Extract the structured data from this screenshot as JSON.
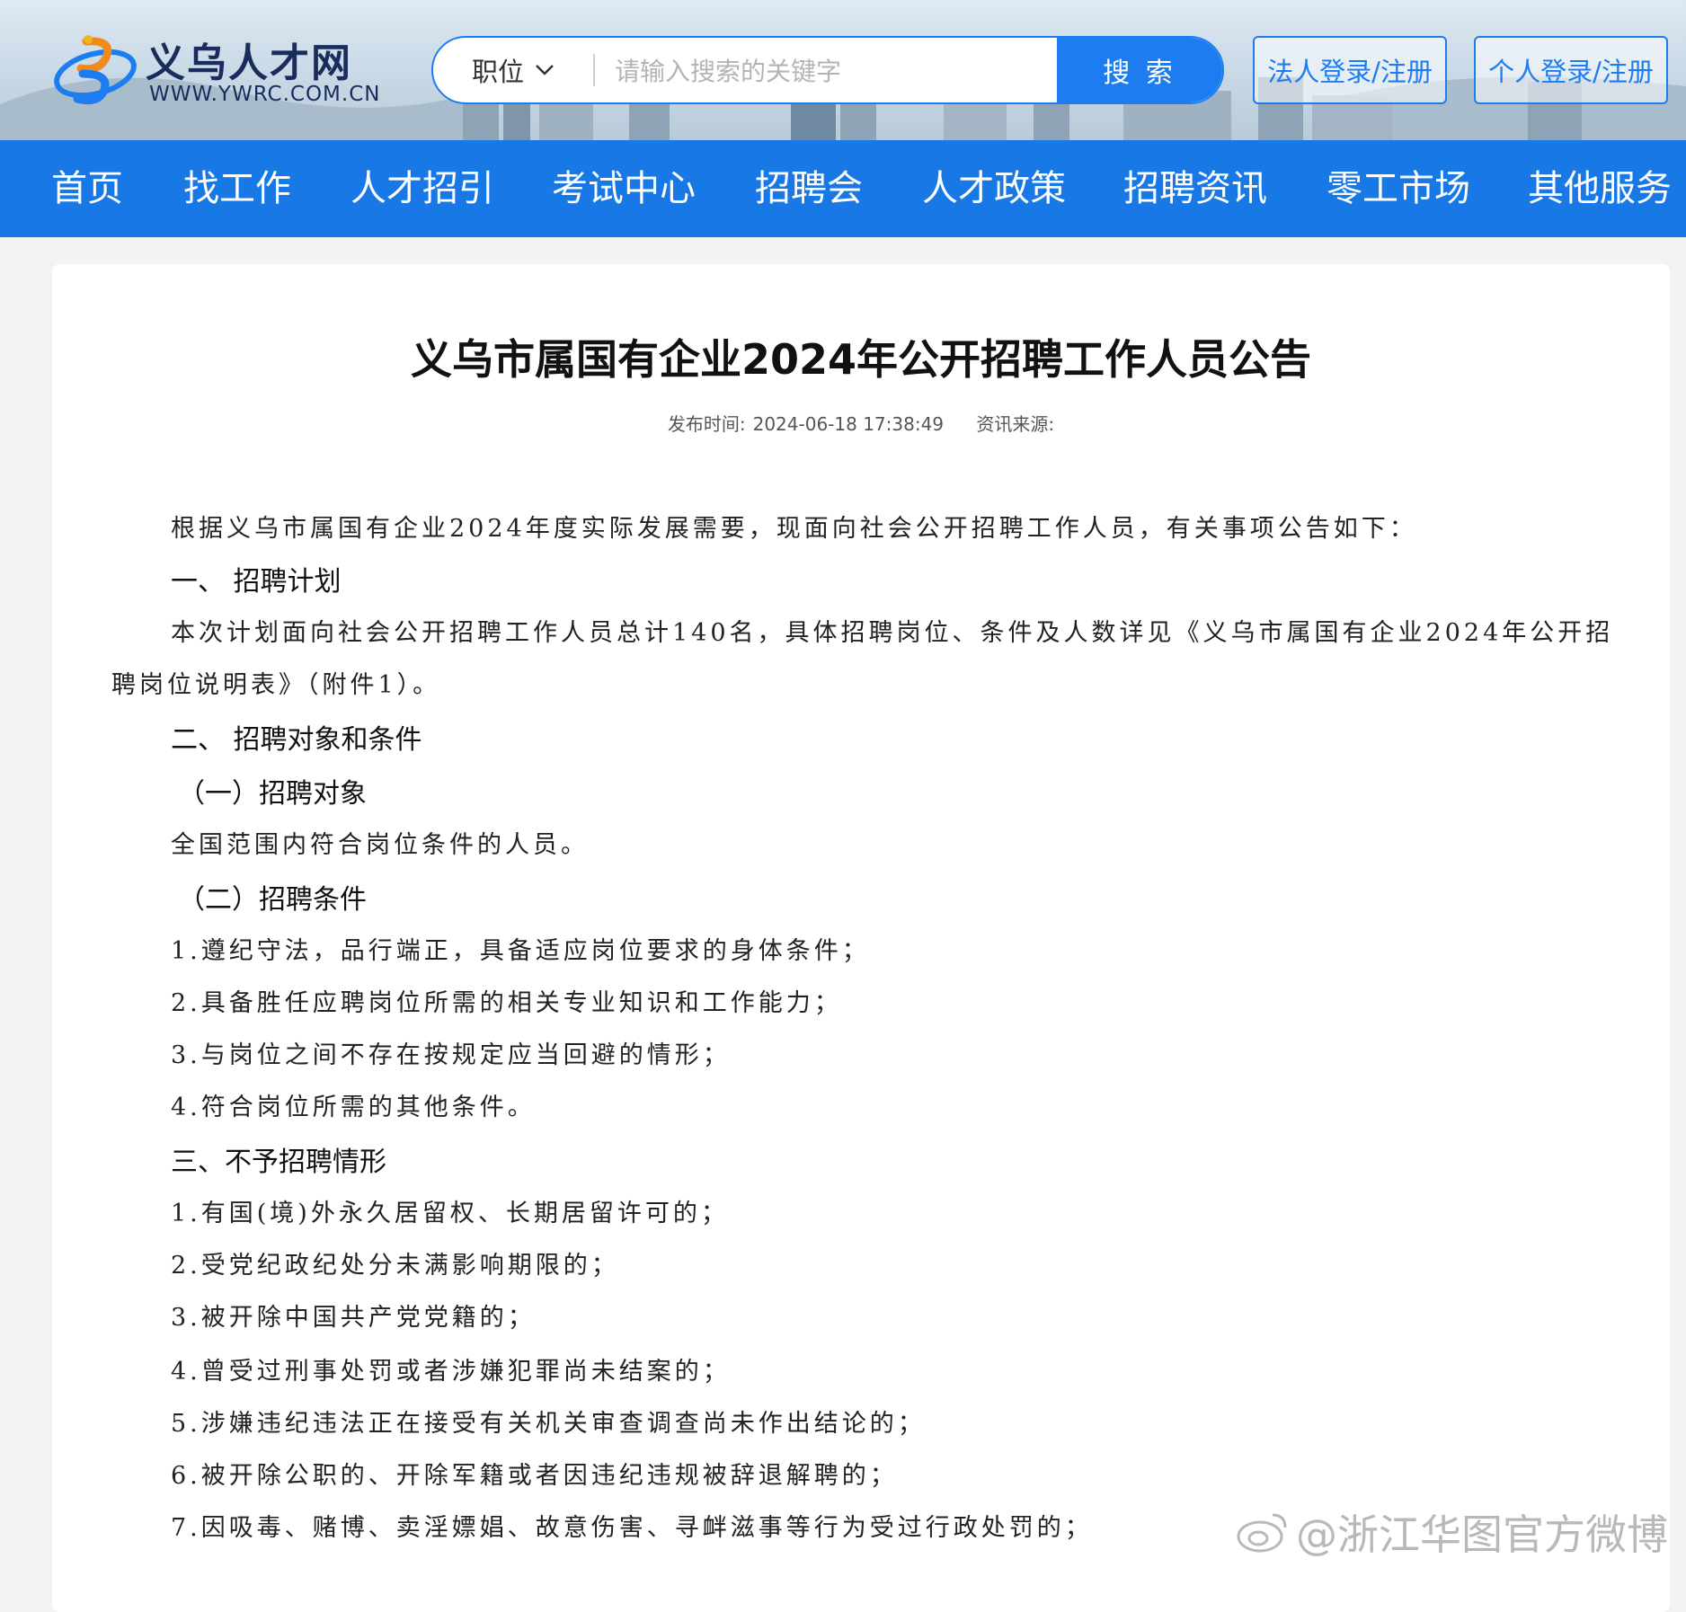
{
  "header": {
    "logo_cn": "义乌人才网",
    "logo_en": "WWW.YWRC.COM.CN",
    "search": {
      "type_label": "职位",
      "placeholder": "请输入搜索的关键字",
      "button": "搜 索"
    },
    "corp_login": "法人登录/注册",
    "personal_login": "个人登录/注册"
  },
  "nav": {
    "items": [
      "首页",
      "找工作",
      "人才招引",
      "考试中心",
      "招聘会",
      "人才政策",
      "招聘资讯",
      "零工市场",
      "其他服务"
    ]
  },
  "article": {
    "title": "义乌市属国有企业2024年公开招聘工作人员公告",
    "publish_time_label": "发布时间:",
    "publish_time": "2024-06-18 17:38:49",
    "source_label": "资讯来源:",
    "intro": "根据义乌市属国有企业2024年度实际发展需要，现面向社会公开招聘工作人员，有关事项公告如下：",
    "section1_heading": "一、  招聘计划",
    "section1_line1": "本次计划面向社会公开招聘工作人员总计140名，具体招聘岗位、条件及人数详见《义乌市属国有企业2024年公开招",
    "section1_line2": "聘岗位说明表》（附件1）。",
    "section2_heading": "二、  招聘对象和条件",
    "section2_sub1": "（一）招聘对象",
    "section2_sub1_text": "全国范围内符合岗位条件的人员。",
    "section2_sub2": "（二）招聘条件",
    "conditions": [
      "1.遵纪守法，品行端正，具备适应岗位要求的身体条件；",
      "2.具备胜任应聘岗位所需的相关专业知识和工作能力；",
      "3.与岗位之间不存在按规定应当回避的情形；",
      "4.符合岗位所需的其他条件。"
    ],
    "section3_heading": "三、不予招聘情形",
    "exclusions": [
      "1.有国(境)外永久居留权、长期居留许可的；",
      "2.受党纪政纪处分未满影响期限的；",
      "3.被开除中国共产党党籍的；",
      "4.曾受过刑事处罚或者涉嫌犯罪尚未结案的；",
      "5.涉嫌违纪违法正在接受有关机关审查调查尚未作出结论的；",
      "6.被开除公职的、开除军籍或者因违纪违规被辞退解聘的；",
      "7.因吸毒、赌博、卖淫嫖娼、故意伤害、寻衅滋事等行为受过行政处罚的；"
    ]
  },
  "watermark": "@浙江华图官方微博",
  "colors": {
    "brand_blue": "#1778e6",
    "search_blue": "#1c7cf0",
    "logo_navy": "#1a2c5b"
  }
}
